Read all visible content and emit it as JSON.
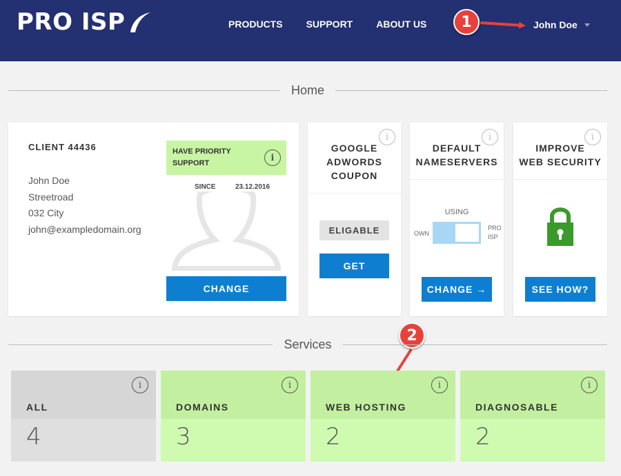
{
  "header": {
    "logo_text": "PRO ISP",
    "nav": [
      "PRODUCTS",
      "SUPPORT",
      "ABOUT US"
    ],
    "user_name": "John Doe"
  },
  "annotations": [
    "1",
    "2"
  ],
  "sections": {
    "home": "Home",
    "services": "Services"
  },
  "client_card": {
    "title": "CLIENT 44436",
    "name": "John Doe",
    "street": "Streetroad",
    "city": "032 City",
    "email": "john@exampledomain.org",
    "priority_label": "HAVE PRIORITY SUPPORT",
    "since_label": "SINCE",
    "since_date": "23.12.2016",
    "change_button": "CHANGE"
  },
  "coupon_card": {
    "title_lines": [
      "GOOGLE",
      "ADWORDS",
      "COUPON"
    ],
    "status": "ELIGABLE",
    "get_button": "GET"
  },
  "nameservers_card": {
    "title_lines": [
      "DEFAULT",
      "NAMESERVERS"
    ],
    "using_label": "USING",
    "toggle_left": "OWN",
    "toggle_right_lines": [
      "PRO",
      "ISP"
    ],
    "change_button": "CHANGE →"
  },
  "security_card": {
    "title_lines": [
      "IMPROVE",
      "WEB SECURITY"
    ],
    "see_how_button": "SEE HOW?"
  },
  "services": [
    {
      "label": "ALL",
      "count": "4"
    },
    {
      "label": "DOMAINS",
      "count": "3"
    },
    {
      "label": "WEB HOSTING",
      "count": "2"
    },
    {
      "label": "DIAGNOSABLE",
      "count": "2"
    }
  ],
  "info_icon_glyph": "i",
  "colors": {
    "header_bg": "#233071",
    "button_blue": "#0e7fd0",
    "priority_green": "#c8f5a4",
    "service_green": "#c2f0a0",
    "service_grey": "#d6d6d6",
    "lock_green": "#3a9a2a",
    "annotation_red": "#e8413b"
  }
}
